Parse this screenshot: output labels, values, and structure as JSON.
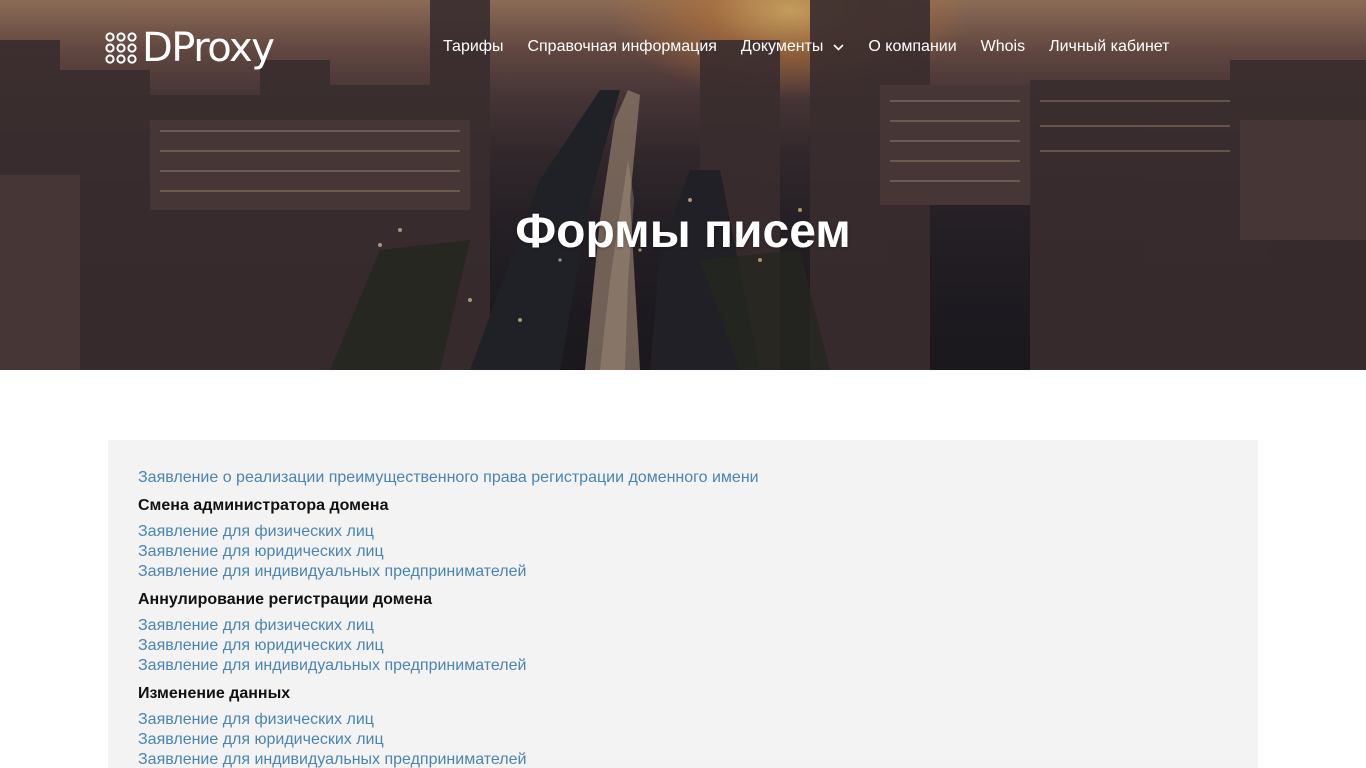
{
  "header": {
    "logo_text": "DProxy",
    "nav": [
      {
        "label": "Тарифы"
      },
      {
        "label": "Справочная информация"
      },
      {
        "label": "Документы",
        "has_dropdown": true
      },
      {
        "label": "О компании"
      },
      {
        "label": "Whois"
      },
      {
        "label": "Личный кабинет"
      }
    ]
  },
  "hero": {
    "title": "Формы писем"
  },
  "content": {
    "top_link": "Заявление о реализации преимущественного права регистрации доменного имени",
    "sections": [
      {
        "heading": "Смена администратора домена",
        "links": [
          "Заявление для физических лиц",
          "Заявление для юридических лиц",
          "Заявление для индивидуальных предпринимателей"
        ]
      },
      {
        "heading": "Аннулирование регистрации домена",
        "links": [
          "Заявление для физических лиц",
          "Заявление для юридических лиц",
          "Заявление для индивидуальных предпринимателей"
        ]
      },
      {
        "heading": "Изменение данных",
        "links": [
          "Заявление для физических лиц",
          "Заявление для юридических лиц",
          "Заявление для индивидуальных предпринимателей"
        ]
      }
    ]
  },
  "colors": {
    "link": "#4b84b0",
    "content_background": "#f3f3f4",
    "heading_text": "#111111",
    "nav_text": "#ffffff"
  }
}
